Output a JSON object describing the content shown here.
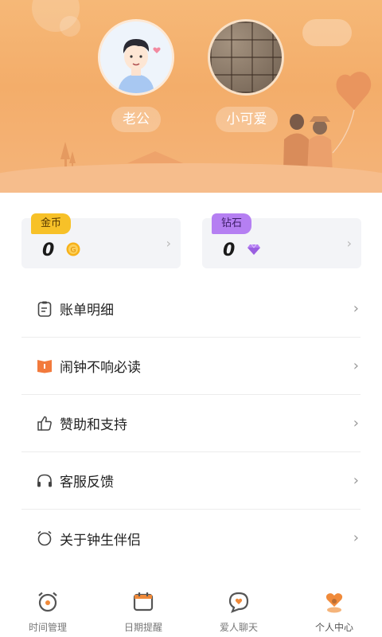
{
  "header": {
    "husband": {
      "name": "老公"
    },
    "wife": {
      "name": "小可爱"
    }
  },
  "wallet": {
    "coins": {
      "label": "金币",
      "value": "0",
      "icon": "gold-coin-icon"
    },
    "diamonds": {
      "label": "钻石",
      "value": "0",
      "icon": "purple-diamond-icon"
    }
  },
  "menu": {
    "items": [
      {
        "label": "账单明细",
        "icon": "bill-icon"
      },
      {
        "label": "闹钟不响必读",
        "icon": "book-icon"
      },
      {
        "label": "赞助和支持",
        "icon": "thumbs-up-icon"
      },
      {
        "label": "客服反馈",
        "icon": "headset-icon"
      },
      {
        "label": "关于钟生伴侣",
        "icon": "clock-icon"
      }
    ]
  },
  "tabbar": {
    "tabs": [
      {
        "label": "时间管理",
        "icon": "alarm-clock-icon"
      },
      {
        "label": "日期提醒",
        "icon": "calendar-icon"
      },
      {
        "label": "爱人聊天",
        "icon": "chat-heart-icon"
      },
      {
        "label": "个人中心",
        "icon": "heart-person-icon",
        "active": true
      }
    ]
  },
  "colors": {
    "header_bg": "#f3ad6a",
    "coin_badge": "#f7c128",
    "diamond_badge": "#b57ff2",
    "accent": "#f08a3a"
  }
}
